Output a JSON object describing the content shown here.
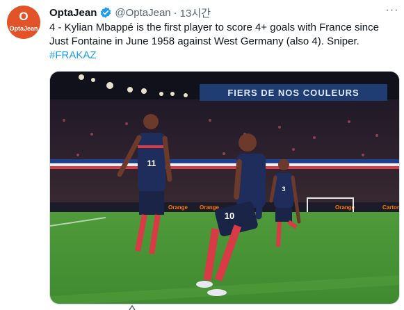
{
  "account": {
    "avatar_mark": "O",
    "avatar_brand": "OptaJean",
    "display_name": "OptaJean",
    "handle": "@OptaJean",
    "separator": "·",
    "time_ago": "13시간"
  },
  "tweet": {
    "text": "4 - Kylian Mbappé is the first player to score 4+ goals with France since Just Fontaine in June 1958 against West Germany (also 4). Sniper.",
    "hashtag": "#FRAKAZ"
  },
  "photo": {
    "banner": "FIERS DE NOS COULEURS",
    "jersey_left": "11",
    "jersey_center": "10",
    "jersey_right": "3",
    "board_1": "Orange",
    "board_2": "Orange",
    "board_3": "Orange",
    "board_4": "Carton"
  },
  "colors": {
    "accent": "#1d9bf0",
    "avatar_bg": "#e2532a",
    "verified": "#1d9bf0"
  }
}
